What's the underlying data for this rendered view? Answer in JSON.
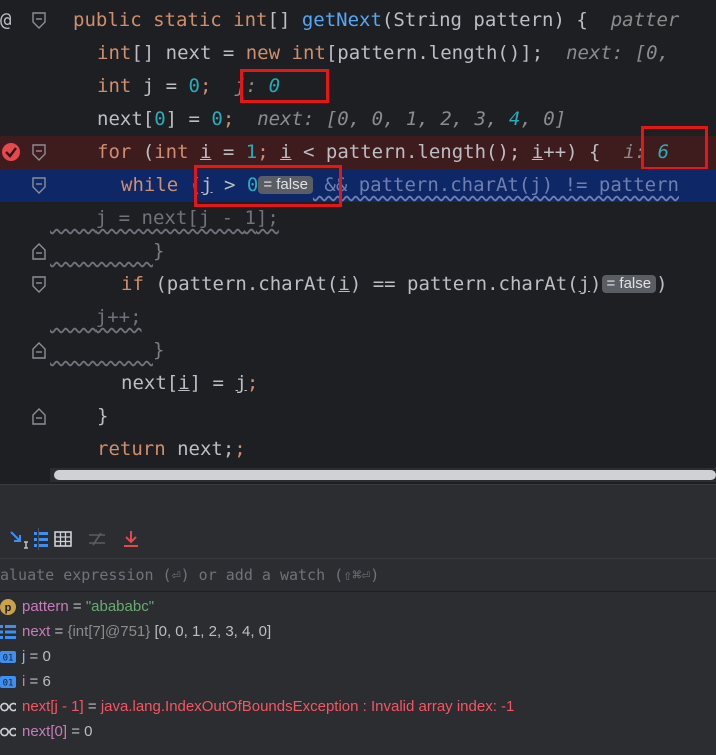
{
  "code": {
    "line1": {
      "at": "@",
      "kw1": "public static",
      "type": "int",
      "brackets": "[] ",
      "method": "getNext",
      "params": "(String pattern) {",
      "hint": "patter"
    },
    "line2": {
      "t1": "int",
      "t2": "[] next = ",
      "kw": "new",
      "t3": " ",
      "t4": "int",
      "t5": "[pattern.length()];",
      "hint": "next: [0,"
    },
    "line3": {
      "kw": "int",
      "v": " j = ",
      "num": "0",
      "semi": ";",
      "hint_label": "j: ",
      "hint_val": "0"
    },
    "line4": {
      "t1": "next[",
      "n1": "0",
      "t2": "] = ",
      "n2": "0",
      "t3": ";",
      "hint": "next: [0, 0, 1, 2, 3, ",
      "hint_num": "4",
      "hint_tail": ", 0]"
    },
    "line5": {
      "kw": "for",
      "t1": " (",
      "kw2": "int",
      "t2": " ",
      "iv": "i",
      "t3": " = ",
      "n1": "1",
      "t4": "; ",
      "iv2": "i",
      "t5": " < pattern.length(); ",
      "iv3": "i",
      "t6": "++) {",
      "hint_label": "i: ",
      "hint_val": "6"
    },
    "line6": {
      "kw": "while",
      "t1": " (",
      "jv": "j",
      "t2": " > ",
      "n": "0",
      "badge": "= false",
      "t3": " && pattern.charAt(j) != pattern"
    },
    "line7": {
      "t1": "j = next[j - ",
      "n": "1",
      "t2": "];"
    },
    "line8": {
      "brace": "}"
    },
    "line9": {
      "kw": "if",
      "t1": " (pattern.charAt(",
      "iv": "i",
      "t2": ") == pattern.charAt(",
      "jv": "j",
      "t3": ")",
      "badge": "= false",
      "t4": ")"
    },
    "line10": {
      "t1": "j++;"
    },
    "line11": {
      "brace": "}"
    },
    "line12": {
      "t1": "next[",
      "iv": "i",
      "t2": "] = ",
      "jv": "j",
      "t3": ";"
    },
    "line13": {
      "brace": "}"
    },
    "line14": {
      "kw": "return",
      "t1": " next;"
    }
  },
  "eval": {
    "placeholder": "aluate expression (⏎) or add a watch (⇧⌘⏎)"
  },
  "variables": [
    {
      "icon": "p-icon",
      "name": "pattern",
      "eq": " = ",
      "value": "\"abababc\"",
      "kind": "str"
    },
    {
      "icon": "array-icon",
      "name": "next",
      "eq": " = ",
      "type": "{int[7]@751} ",
      "value": "[0, 0, 1, 2, 3, 4, 0]",
      "kind": "arr"
    },
    {
      "icon": "int-icon",
      "name": "j",
      "eq": " = ",
      "value": "0",
      "kind": "int"
    },
    {
      "icon": "int-icon",
      "name": "i",
      "eq": " = ",
      "value": "6",
      "kind": "int"
    },
    {
      "icon": "watch-icon",
      "name": "next[j - 1]",
      "eq": " = ",
      "value": "java.lang.IndexOutOfBoundsException : Invalid array index: -1",
      "kind": "err"
    },
    {
      "icon": "watch-icon",
      "name": "next[0]",
      "eq": " = ",
      "value": "0",
      "kind": "int"
    }
  ],
  "colors": {
    "bg": "#1e1f22",
    "keyword": "#cf8e6d",
    "method": "#56a8f5",
    "number": "#2aacb8",
    "breakpoint_row": "#3e1b1d",
    "exec_row": "#0d2767",
    "highlight_box": "#e51616"
  }
}
